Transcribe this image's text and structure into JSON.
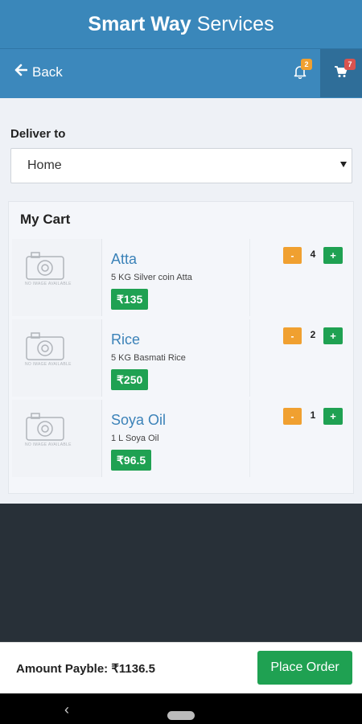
{
  "app": {
    "title_bold": "Smart Way",
    "title_rest": "Services"
  },
  "nav": {
    "back_label": "Back",
    "notification_count": "2",
    "cart_count": "7"
  },
  "deliver": {
    "label": "Deliver to",
    "selected": "Home"
  },
  "cart": {
    "title": "My Cart",
    "no_image_text": "NO IMAGE AVAILABLE",
    "items": [
      {
        "name": "Atta",
        "description": "5 KG Silver coin Atta",
        "price": "₹135",
        "quantity": "4",
        "minus_label": "-",
        "plus_label": "+"
      },
      {
        "name": "Rice",
        "description": "5 KG Basmati Rice",
        "price": "₹250",
        "quantity": "2",
        "minus_label": "-",
        "plus_label": "+"
      },
      {
        "name": "Soya Oil",
        "description": "1 L Soya Oil",
        "price": "₹96.5",
        "quantity": "1",
        "minus_label": "-",
        "plus_label": "+"
      }
    ]
  },
  "footer": {
    "amount_text": "Amount Payble: ₹1136.5",
    "place_order_label": "Place Order"
  },
  "system_nav": {
    "back_glyph": "‹"
  },
  "colors": {
    "header": "#3a87ba",
    "primary_green": "#1fa152",
    "accent_orange": "#f0a030",
    "link_blue": "#3b82b8"
  }
}
